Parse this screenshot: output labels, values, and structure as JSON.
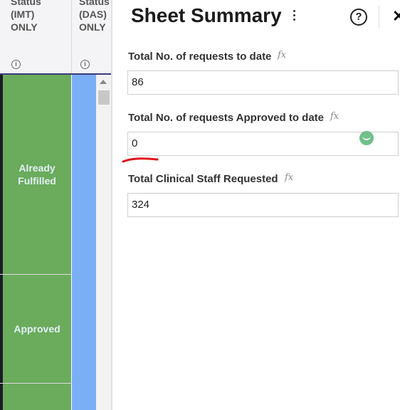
{
  "grid": {
    "columns": [
      {
        "title": "Status\n(IMT)\nONLY",
        "info": "i"
      },
      {
        "title": "Status\n(DAS)\nONLY",
        "info": "i"
      }
    ],
    "rows": [
      {
        "status": "Already\nFulfilled"
      },
      {
        "status": "Approved"
      }
    ],
    "colors": {
      "status_green": "#6aab5c",
      "blue_column": "#7aaef5"
    }
  },
  "panel": {
    "title": "Sheet Summary",
    "menu_icon": "kebab-icon",
    "help_icon": "?",
    "close_icon": "✕",
    "fx_symbol": "fx",
    "fields": [
      {
        "label": "Total No. of requests to date",
        "value": "86"
      },
      {
        "label": "Total No. of requests Approved to date",
        "value": "0"
      },
      {
        "label": "Total Clinical Staff Requested",
        "value": "324"
      }
    ]
  }
}
